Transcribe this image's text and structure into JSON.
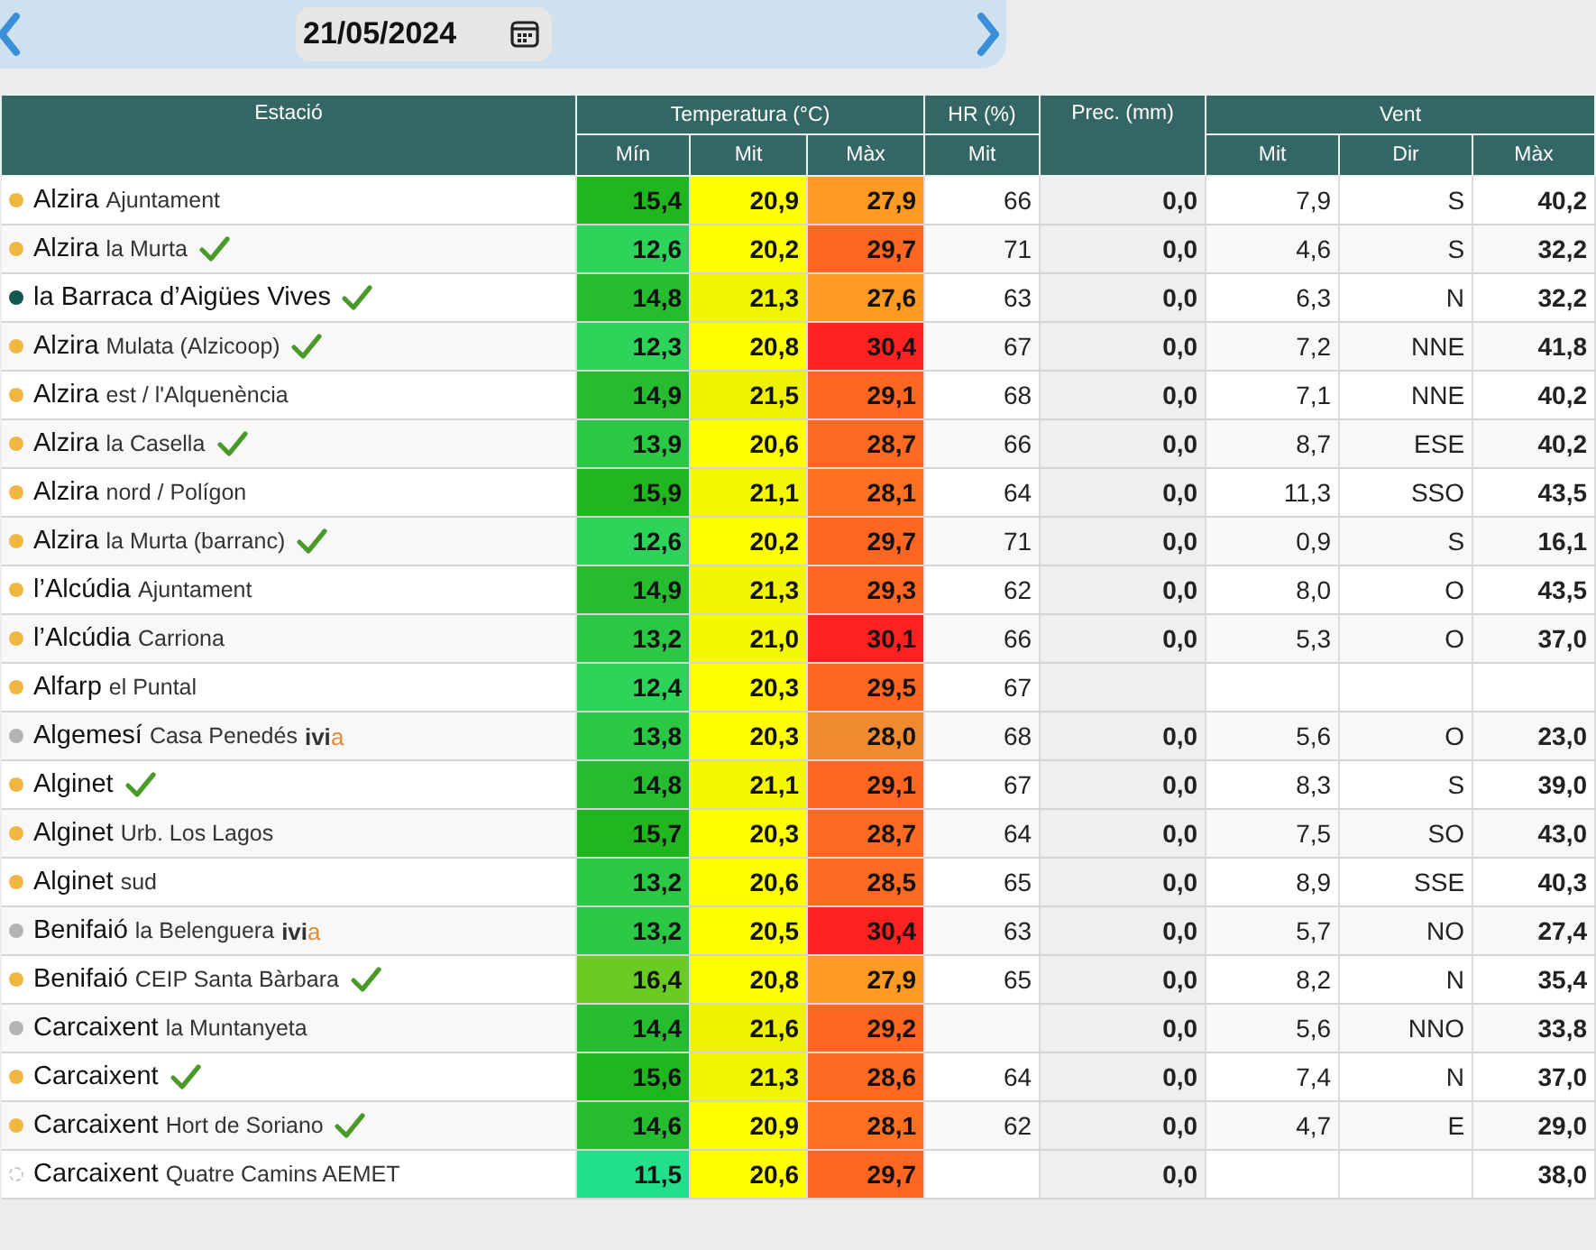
{
  "date_bar": {
    "date": "21/05/2024"
  },
  "table": {
    "group_headers": [
      "Estació",
      "Temperatura (°C)",
      "HR (%)",
      "Prec. (mm)",
      "Vent"
    ],
    "sub_headers": [
      "Mín",
      "Mit",
      "Màx",
      "Mit",
      "Mit",
      "Dir",
      "Màx"
    ],
    "rows": [
      {
        "color": "#f0b840",
        "hollow": false,
        "town": "Alzira",
        "place": "Ajuntament",
        "verified": false,
        "temps": [
          {
            "value": "15,4",
            "color": "#1fb61f"
          },
          {
            "value": "20,9",
            "color": "#ffff00"
          },
          {
            "value": "27,9",
            "color": "#ff9a22"
          }
        ],
        "hr": "66",
        "prec": "0,0",
        "wind": "7,9",
        "dir": "S",
        "gust": "40,2"
      },
      {
        "color": "#f0b840",
        "hollow": false,
        "town": "Alzira",
        "place": "la Murta",
        "verified": true,
        "temps": [
          {
            "value": "12,6",
            "color": "#2ed45a"
          },
          {
            "value": "20,2",
            "color": "#ffff00"
          },
          {
            "value": "29,7",
            "color": "#ff6622"
          }
        ],
        "hr": "71",
        "prec": "0,0",
        "wind": "4,6",
        "dir": "S",
        "gust": "32,2"
      },
      {
        "color": "#12564f",
        "hollow": false,
        "town": "la Barraca d’Aigües Vives",
        "verified": true,
        "temps": [
          {
            "value": "14,8",
            "color": "#26bc30"
          },
          {
            "value": "21,3",
            "color": "#f2f500"
          },
          {
            "value": "27,6",
            "color": "#ff9a22"
          }
        ],
        "hr": "63",
        "prec": "0,0",
        "wind": "6,3",
        "dir": "N",
        "gust": "32,2"
      },
      {
        "color": "#f0b840",
        "hollow": false,
        "town": "Alzira",
        "place": "Mulata (Alzicoop)",
        "verified": true,
        "temps": [
          {
            "value": "12,3",
            "color": "#2ed45a"
          },
          {
            "value": "20,8",
            "color": "#ffff00"
          },
          {
            "value": "30,4",
            "color": "#ff2020"
          }
        ],
        "hr": "67",
        "prec": "0,0",
        "wind": "7,2",
        "dir": "NNE",
        "gust": "41,8"
      },
      {
        "color": "#f0b840",
        "hollow": false,
        "town": "Alzira",
        "place": "est / l'Alquenència",
        "verified": false,
        "temps": [
          {
            "value": "14,9",
            "color": "#26bc30"
          },
          {
            "value": "21,5",
            "color": "#eef200"
          },
          {
            "value": "29,1",
            "color": "#ff6622"
          }
        ],
        "hr": "68",
        "prec": "0,0",
        "wind": "7,1",
        "dir": "NNE",
        "gust": "40,2"
      },
      {
        "color": "#f0b840",
        "hollow": false,
        "town": "Alzira",
        "place": "la Casella",
        "verified": true,
        "temps": [
          {
            "value": "13,9",
            "color": "#2ac844"
          },
          {
            "value": "20,6",
            "color": "#ffff00"
          },
          {
            "value": "28,7",
            "color": "#ff6a22"
          }
        ],
        "hr": "66",
        "prec": "0,0",
        "wind": "8,7",
        "dir": "ESE",
        "gust": "40,2"
      },
      {
        "color": "#f0b840",
        "hollow": false,
        "town": "Alzira",
        "place": "nord / Polígon",
        "verified": false,
        "temps": [
          {
            "value": "15,9",
            "color": "#1fb61f"
          },
          {
            "value": "21,1",
            "color": "#f5f800"
          },
          {
            "value": "28,1",
            "color": "#ff7022"
          }
        ],
        "hr": "64",
        "prec": "0,0",
        "wind": "11,3",
        "dir": "SSO",
        "gust": "43,5"
      },
      {
        "color": "#f0b840",
        "hollow": false,
        "town": "Alzira",
        "place": "la Murta (barranc)",
        "verified": true,
        "temps": [
          {
            "value": "12,6",
            "color": "#2ed45a"
          },
          {
            "value": "20,2",
            "color": "#ffff00"
          },
          {
            "value": "29,7",
            "color": "#ff6622"
          }
        ],
        "hr": "71",
        "prec": "0,0",
        "wind": "0,9",
        "dir": "S",
        "gust": "16,1"
      },
      {
        "color": "#f0b840",
        "hollow": false,
        "town": "l’Alcúdia",
        "place": "Ajuntament",
        "verified": false,
        "temps": [
          {
            "value": "14,9",
            "color": "#26bc30"
          },
          {
            "value": "21,3",
            "color": "#f2f500"
          },
          {
            "value": "29,3",
            "color": "#ff6622"
          }
        ],
        "hr": "62",
        "prec": "0,0",
        "wind": "8,0",
        "dir": "O",
        "gust": "43,5"
      },
      {
        "color": "#f0b840",
        "hollow": false,
        "town": "l’Alcúdia",
        "place": "Carriona",
        "verified": false,
        "temps": [
          {
            "value": "13,2",
            "color": "#2ac844"
          },
          {
            "value": "21,0",
            "color": "#f5f800"
          },
          {
            "value": "30,1",
            "color": "#ff2020"
          }
        ],
        "hr": "66",
        "prec": "0,0",
        "wind": "5,3",
        "dir": "O",
        "gust": "37,0"
      },
      {
        "color": "#f0b840",
        "hollow": false,
        "town": "Alfarp",
        "place": "el Puntal",
        "verified": false,
        "temps": [
          {
            "value": "12,4",
            "color": "#2ed45a"
          },
          {
            "value": "20,3",
            "color": "#ffff00"
          },
          {
            "value": "29,5",
            "color": "#ff6622"
          }
        ],
        "hr": "67"
      },
      {
        "color": "#b4b4b4",
        "hollow": false,
        "town": "Algemesí",
        "place": "Casa Penedés",
        "badge": "ivia",
        "verified": false,
        "temps": [
          {
            "value": "13,8",
            "color": "#2ac844"
          },
          {
            "value": "20,3",
            "color": "#ffff00"
          },
          {
            "value": "28,0",
            "color": "#f08a30"
          }
        ],
        "hr": "68",
        "prec": "0,0",
        "wind": "5,6",
        "dir": "O",
        "gust": "23,0"
      },
      {
        "color": "#f0b840",
        "hollow": false,
        "town": "Alginet",
        "verified": true,
        "temps": [
          {
            "value": "14,8",
            "color": "#26bc30"
          },
          {
            "value": "21,1",
            "color": "#f5f800"
          },
          {
            "value": "29,1",
            "color": "#ff6622"
          }
        ],
        "hr": "67",
        "prec": "0,0",
        "wind": "8,3",
        "dir": "S",
        "gust": "39,0"
      },
      {
        "color": "#f0b840",
        "hollow": false,
        "town": "Alginet",
        "place": "Urb. Los Lagos",
        "verified": false,
        "temps": [
          {
            "value": "15,7",
            "color": "#1fb61f"
          },
          {
            "value": "20,3",
            "color": "#ffff00"
          },
          {
            "value": "28,7",
            "color": "#ff6a22"
          }
        ],
        "hr": "64",
        "prec": "0,0",
        "wind": "7,5",
        "dir": "SO",
        "gust": "43,0"
      },
      {
        "color": "#f0b840",
        "hollow": false,
        "town": "Alginet",
        "place": "sud",
        "verified": false,
        "temps": [
          {
            "value": "13,2",
            "color": "#2ac844"
          },
          {
            "value": "20,6",
            "color": "#ffff00"
          },
          {
            "value": "28,5",
            "color": "#ff6a22"
          }
        ],
        "hr": "65",
        "prec": "0,0",
        "wind": "8,9",
        "dir": "SSE",
        "gust": "40,3"
      },
      {
        "color": "#b4b4b4",
        "hollow": false,
        "town": "Benifaió",
        "place": "la Belenguera",
        "badge": "ivia",
        "verified": false,
        "temps": [
          {
            "value": "13,2",
            "color": "#2ac844"
          },
          {
            "value": "20,5",
            "color": "#ffff00"
          },
          {
            "value": "30,4",
            "color": "#ff2020"
          }
        ],
        "hr": "63",
        "prec": "0,0",
        "wind": "5,7",
        "dir": "NO",
        "gust": "27,4"
      },
      {
        "color": "#f0b840",
        "hollow": false,
        "town": "Benifaió",
        "place": "CEIP Santa Bàrbara",
        "verified": true,
        "temps": [
          {
            "value": "16,4",
            "color": "#6acc22"
          },
          {
            "value": "20,8",
            "color": "#ffff00"
          },
          {
            "value": "27,9",
            "color": "#ff9a22"
          }
        ],
        "hr": "65",
        "prec": "0,0",
        "wind": "8,2",
        "dir": "N",
        "gust": "35,4"
      },
      {
        "color": "#b4b4b4",
        "hollow": false,
        "town": "Carcaixent",
        "place": "la Muntanyeta",
        "verified": false,
        "temps": [
          {
            "value": "14,4",
            "color": "#26bc30"
          },
          {
            "value": "21,6",
            "color": "#eef200"
          },
          {
            "value": "29,2",
            "color": "#ff6622"
          }
        ],
        "prec": "0,0",
        "wind": "5,6",
        "dir": "NNO",
        "gust": "33,8"
      },
      {
        "color": "#f0b840",
        "hollow": false,
        "town": "Carcaixent",
        "verified": true,
        "temps": [
          {
            "value": "15,6",
            "color": "#1fb61f"
          },
          {
            "value": "21,3",
            "color": "#f2f500"
          },
          {
            "value": "28,6",
            "color": "#ff6a22"
          }
        ],
        "hr": "64",
        "prec": "0,0",
        "wind": "7,4",
        "dir": "N",
        "gust": "37,0"
      },
      {
        "color": "#f0b840",
        "hollow": false,
        "town": "Carcaixent",
        "place": "Hort de Soriano",
        "verified": true,
        "temps": [
          {
            "value": "14,6",
            "color": "#26bc30"
          },
          {
            "value": "20,9",
            "color": "#ffff00"
          },
          {
            "value": "28,1",
            "color": "#ff7022"
          }
        ],
        "hr": "62",
        "prec": "0,0",
        "wind": "4,7",
        "dir": "E",
        "gust": "29,0"
      },
      {
        "color": "#c8c8c8",
        "hollow": true,
        "town": "Carcaixent",
        "place": "Quatre Camins AEMET",
        "verified": false,
        "temps": [
          {
            "value": "11,5",
            "color": "#22e08a"
          },
          {
            "value": "20,6",
            "color": "#ffff00"
          },
          {
            "value": "29,7",
            "color": "#ff6622"
          }
        ],
        "prec": "0,0",
        "gust": "38,0"
      }
    ]
  }
}
